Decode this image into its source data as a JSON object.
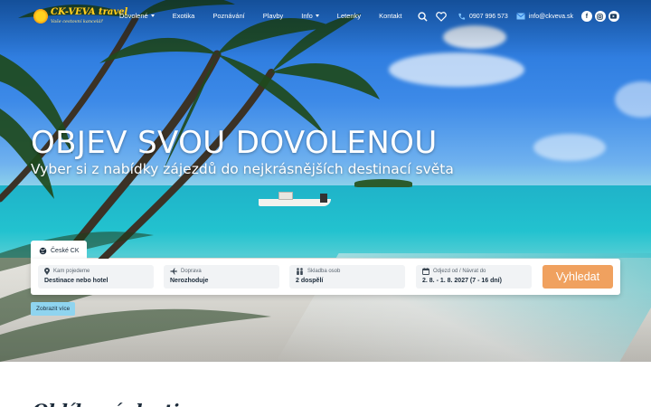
{
  "brand": {
    "name": "CK-VEVA travel",
    "tagline": "Vaše cestovní kancelář",
    "colors": {
      "primary_text": "#1c2b3a",
      "accent": "#f0a15f",
      "info": "#8fd4ef"
    }
  },
  "nav": {
    "items": [
      {
        "label": "Dovolené",
        "dropdown": true
      },
      {
        "label": "Exotika",
        "dropdown": false
      },
      {
        "label": "Poznávání",
        "dropdown": false
      },
      {
        "label": "Plavby",
        "dropdown": false
      },
      {
        "label": "Info",
        "dropdown": true
      },
      {
        "label": "Letenky",
        "dropdown": false
      },
      {
        "label": "Kontakt",
        "dropdown": false
      }
    ],
    "phone": "0907 996 573",
    "email": "info@ckveva.sk",
    "icons": [
      "search-icon",
      "heart-icon",
      "phone-icon",
      "mail-icon",
      "facebook-icon",
      "instagram-icon",
      "youtube-icon"
    ]
  },
  "hero": {
    "title": "OBJEV SVOU DOVOLENOU",
    "subtitle": "Vyber si z nabídky zájezdů do nejkrásnějších destinací světa"
  },
  "search": {
    "tab_label": "České CK",
    "fields": [
      {
        "label": "Kam pojedeme",
        "value": "Destinace nebo hotel",
        "icon": "location-pin-icon"
      },
      {
        "label": "Doprava",
        "value": "Nerozhoduje",
        "icon": "plane-icon"
      },
      {
        "label": "Skladba osob",
        "value": "2 dospělí",
        "icon": "people-icon"
      },
      {
        "label": "Odjezd od / Návrat do",
        "value": "2. 8. - 1. 8. 2027 (7 - 16 dní)",
        "icon": "calendar-icon"
      }
    ],
    "submit_label": "Vyhledat",
    "more_label": "Zobrazit více"
  },
  "below": {
    "section_title": "Oblíbené destinace"
  }
}
